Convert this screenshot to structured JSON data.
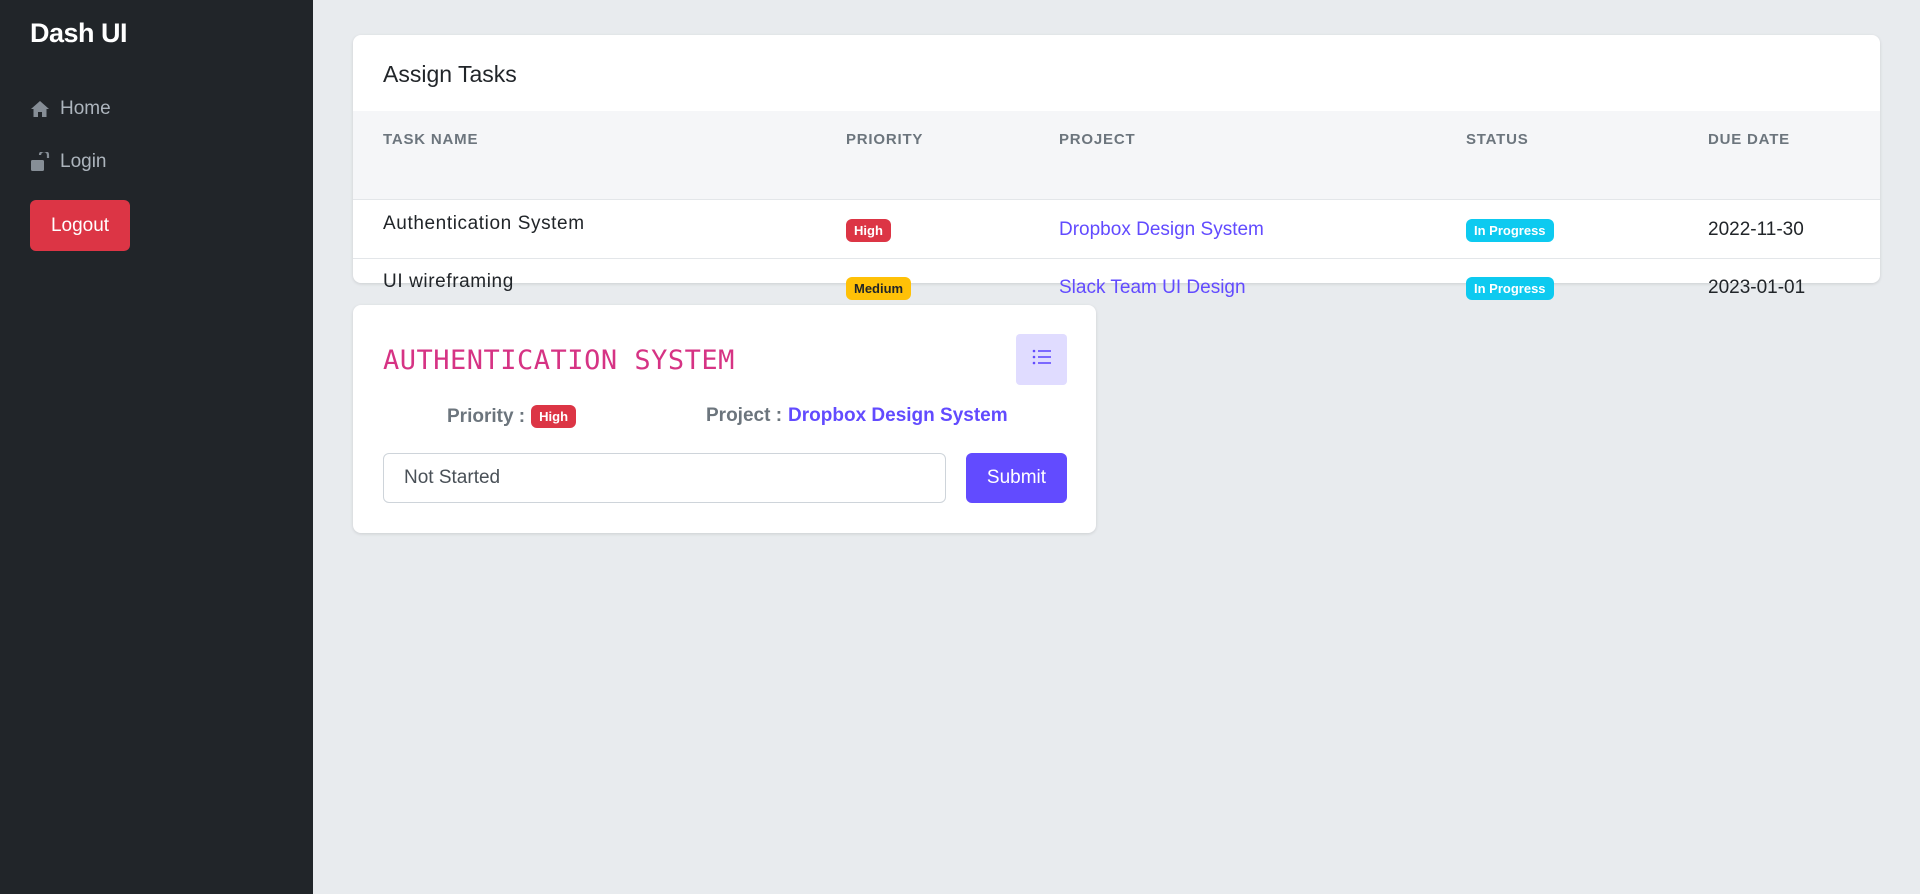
{
  "sidebar": {
    "brand": "Dash UI",
    "items": [
      {
        "label": "Home",
        "icon": "home-icon"
      },
      {
        "label": "Login",
        "icon": "unlock-icon"
      }
    ],
    "logout_label": "Logout"
  },
  "tasks": {
    "title": "Assign Tasks",
    "columns": [
      "TASK NAME",
      "PRIORITY",
      "PROJECT",
      "STATUS",
      "DUE DATE"
    ],
    "rows": [
      {
        "name": "Authentication System",
        "priority": "High",
        "project": "Dropbox Design System",
        "status": "In Progress",
        "due": "2022-11-30"
      },
      {
        "name": "UI wireframing",
        "priority": "Medium",
        "project": "Slack Team UI Design",
        "status": "In Progress",
        "due": "2023-01-01"
      }
    ]
  },
  "detail": {
    "title": "AUTHENTICATION SYSTEM",
    "list_icon": "list-icon",
    "priority_label": "Priority :",
    "priority_value": "High",
    "project_label": "Project :",
    "project_value": "Dropbox Design System",
    "status_value": "Not Started",
    "submit_label": "Submit"
  },
  "colors": {
    "sidebar_bg": "#212529",
    "accent": "#624bff",
    "danger": "#dc3545",
    "warning": "#ffc107",
    "info": "#0dcaf0",
    "title_pink": "#d63384"
  }
}
